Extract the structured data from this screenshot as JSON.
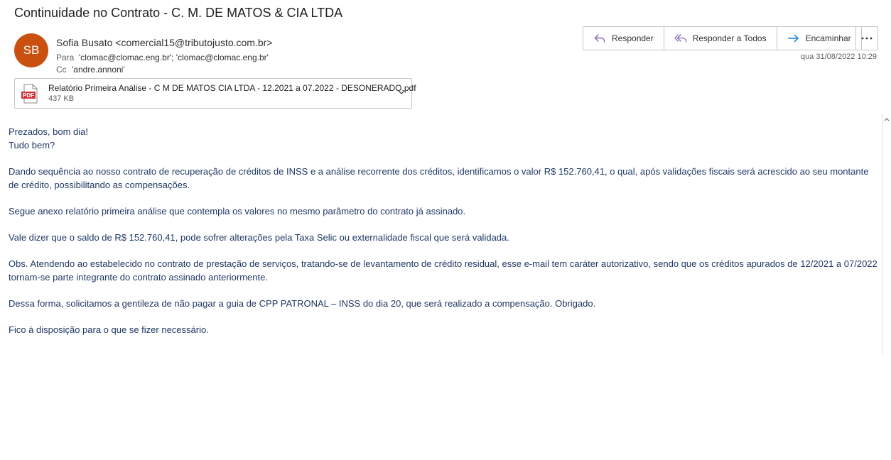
{
  "email": {
    "subject": "Continuidade no Contrato - C. M. DE MATOS & CIA LTDA",
    "avatar_initials": "SB",
    "avatar_color": "#ca5010",
    "from": "Sofia Busato <comercial15@tributojusto.com.br>",
    "to_label": "Para",
    "to": "'clomac@clomac.eng.br'; 'clomac@clomac.eng.br'",
    "cc_label": "Cc",
    "cc": "'andre.annoni'",
    "date": "qua 31/08/2022 10:29"
  },
  "actions": {
    "reply": "Responder",
    "reply_all": "Responder a Todos",
    "forward": "Encaminhar",
    "more_icon": "more-icon"
  },
  "attachment": {
    "icon": "pdf-icon",
    "icon_text": "PDF",
    "name": "Relatório Primeira Análise - C M DE MATOS CIA LTDA - 12.2021 a 07.2022 - DESONERADO.pdf",
    "size": "437 KB"
  },
  "body": {
    "greeting1": "Prezados, bom dia!",
    "greeting2": "Tudo bem?",
    "p1": "Dando sequência ao nosso contrato de recuperação de créditos de INSS e a análise recorrente dos créditos, identificamos o valor R$ 152.760,41, o qual, após validações fiscais será acrescido ao seu montante de crédito, possibilitando as compensações.",
    "p2": "Segue anexo relatório primeira análise que contempla os valores no mesmo parâmetro do contrato já assinado.",
    "p3": "Vale dizer que o saldo de R$ 152.760,41, pode sofrer alterações pela Taxa Selic ou externalidade fiscal que será validada.",
    "p4": "Obs. Atendendo ao estabelecido no contrato de prestação de serviços, tratando-se de levantamento de crédito residual, esse e-mail tem caráter autorizativo, sendo que os créditos apurados de 12/2021 a 07/2022 tornam-se parte integrante do contrato assinado anteriormente.",
    "p5": "Dessa forma, solicitamos a gentileza de não pagar a guia de CPP PATRONAL – INSS do dia 20, que será realizado a compensação. Obrigado.",
    "p6": "Fico à disposição para o que se fizer necessário."
  },
  "colors": {
    "body_text": "#1f3864",
    "reply_icon": "#8764b8",
    "forward_icon": "#0078d4",
    "pdf_red": "#d13438"
  }
}
